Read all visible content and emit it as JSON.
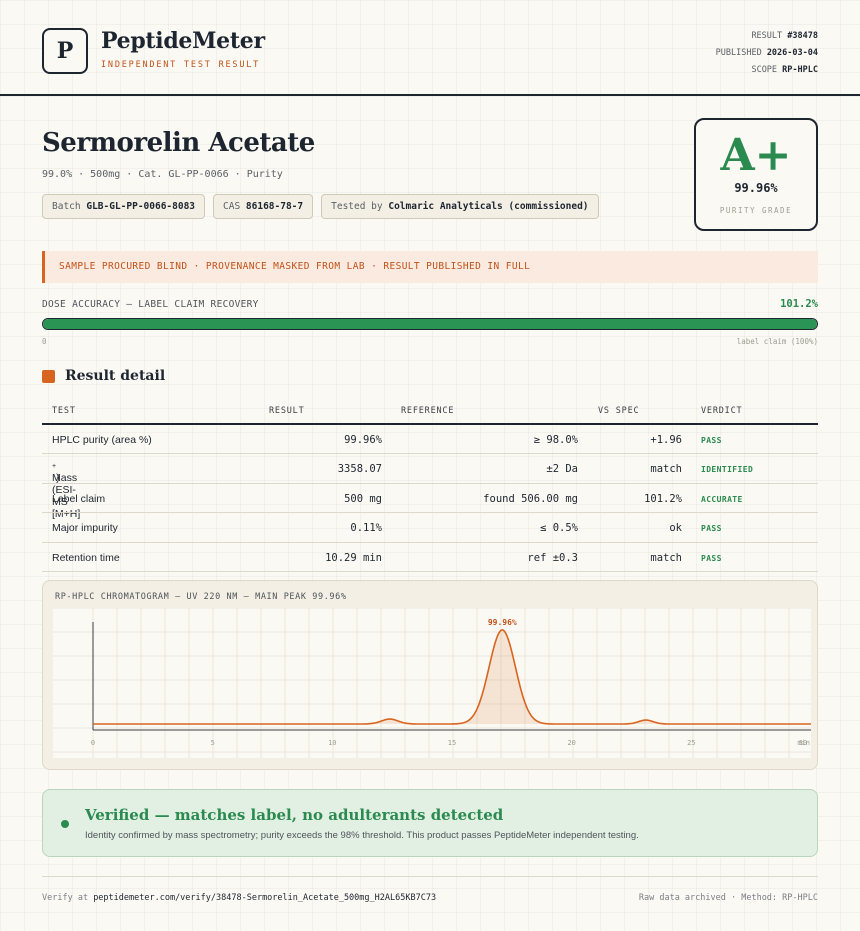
{
  "header": {
    "logo_letter": "P",
    "brand": "PeptideMeter",
    "brand_sub": "INDEPENDENT TEST RESULT",
    "result_label": "RESULT",
    "result_value": "#38478",
    "published_label": "PUBLISHED",
    "published_value": "2026-03-04",
    "scope_label": "SCOPE",
    "scope_value": "RP-HPLC"
  },
  "product": {
    "title": "Sermorelin Acetate",
    "subtitle": "99.0% · 500mg · Cat. GL-PP-0066 · Purity",
    "batch_label": "Batch",
    "batch_value": "GLB-GL-PP-0066-8083",
    "cas_label": "CAS",
    "cas_value": "86168-78-7",
    "tested_label": "Tested by",
    "tested_value": "Colmaric Analyticals (commissioned)"
  },
  "grade": {
    "letter": "A+",
    "value": "99.96%",
    "label": "PURITY GRADE",
    "color": "#2a8a4f"
  },
  "banner": {
    "text": "SAMPLE PROCURED BLIND · PROVENANCE MASKED FROM LAB · RESULT PUBLISHED IN FULL",
    "accent": "#d8651f"
  },
  "dose": {
    "label": "DOSE ACCURACY — LABEL CLAIM RECOVERY",
    "value_text": "101.2%",
    "fill_fraction": 1.0,
    "min_label": "0",
    "max_label": "label claim (100%)"
  },
  "section": {
    "title": "Result detail"
  },
  "table": {
    "headers": {
      "test": "TEST",
      "result": "RESULT",
      "reference": "REFERENCE",
      "vs_spec": "VS SPEC",
      "verdict": "VERDICT"
    },
    "rows": [
      {
        "test": "HPLC purity (area %)",
        "result": "99.96%",
        "reference": "≥ 98.0%",
        "vs_spec": "+1.96",
        "verdict": "PASS"
      },
      {
        "test": "Mass (ESI-MS [M+H]",
        "test_sup": "+",
        "test_end": ")",
        "result": "3358.07",
        "reference": "±2 Da",
        "vs_spec": "match",
        "verdict": "IDENTIFIED"
      },
      {
        "test": "Label claim",
        "result": "500 mg",
        "reference": "found 506.00 mg",
        "vs_spec": "101.2%",
        "verdict": "ACCURATE"
      },
      {
        "test": "Major impurity",
        "result": "0.11%",
        "reference": "≤ 0.5%",
        "vs_spec": "ok",
        "verdict": "PASS"
      },
      {
        "test": "Retention time",
        "result": "10.29 min",
        "reference": "ref ±0.3",
        "vs_spec": "match",
        "verdict": "PASS"
      }
    ]
  },
  "chromatogram": {
    "title": "RP-HPLC CHROMATOGRAM — UV 220 NM — MAIN PEAK 99.96%",
    "peak_label": "99.96%",
    "line_color": "#d8651f",
    "chart_data": {
      "type": "line",
      "x_ticks": [
        "0",
        "5",
        "10",
        "15",
        "20",
        "25",
        "30"
      ],
      "x_unit": "min",
      "xlim": [
        0,
        30
      ],
      "peaks": [
        {
          "x": 12.4,
          "height": 0.05,
          "width": 0.35
        },
        {
          "x": 17.1,
          "height": 0.96,
          "width": 0.55
        },
        {
          "x": 23.1,
          "height": 0.04,
          "width": 0.3
        }
      ]
    }
  },
  "verified": {
    "title": "Verified — matches label, no adulterants detected",
    "subtitle": "Identity confirmed by mass spectrometry; purity exceeds the 98% threshold. This product passes PeptideMeter independent testing."
  },
  "footer": {
    "verify_label": "Verify at",
    "verify_url": "peptidemeter.com/verify/38478-Sermorelin_Acetate_500mg_H2AL65KB7C73",
    "right_text": "Raw data archived · Method: RP-HPLC"
  }
}
